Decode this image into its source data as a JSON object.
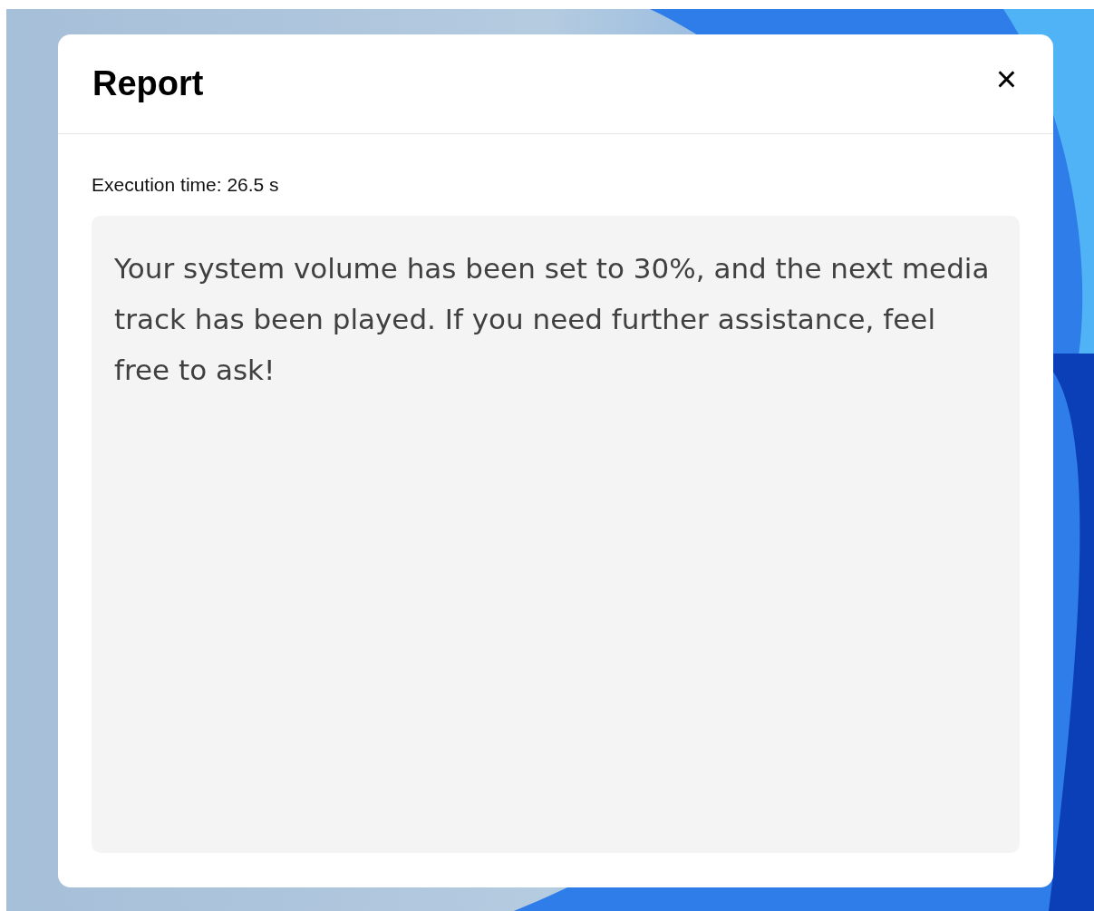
{
  "dialog": {
    "title": "Report",
    "close_label": "×",
    "execution_time": "Execution time: 26.5 s",
    "message": "Your system volume has been set to 30%, and the next media track has been played. If you need further assistance, feel free to ask!"
  }
}
